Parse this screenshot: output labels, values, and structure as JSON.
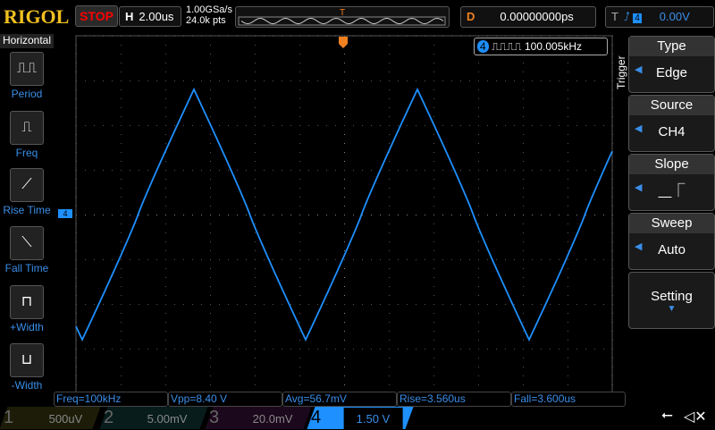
{
  "header": {
    "logo": "RIGOL",
    "run_state": "STOP",
    "h_label": "H",
    "timebase": "2.00us",
    "sample_rate": "1.00GSa/s",
    "memory_depth": "24.0k pts",
    "delay_label": "D",
    "delay": "0.00000000ps",
    "trigger_label": "T",
    "trigger_source": "4",
    "trigger_level": "0.00V"
  },
  "left_menu": {
    "title": "Horizontal",
    "items": [
      {
        "label": "Period"
      },
      {
        "label": "Freq"
      },
      {
        "label": "Rise Time"
      },
      {
        "label": "Fall Time"
      },
      {
        "label": "+Width"
      },
      {
        "label": "-Width"
      }
    ]
  },
  "freq_counter": {
    "channel": "4",
    "value": "100.005kHz"
  },
  "right_menu": {
    "title": "Trigger",
    "items": [
      {
        "title": "Type",
        "value": "Edge"
      },
      {
        "title": "Source",
        "value": "CH4"
      },
      {
        "title": "Slope",
        "value": "rising-edge"
      },
      {
        "title": "Sweep",
        "value": "Auto"
      }
    ],
    "setting": "Setting"
  },
  "measurements": [
    "Freq=100kHz",
    "Vpp=8.40 V",
    "Avg=56.7mV",
    "Rise=3.560us",
    "Fall=3.600us"
  ],
  "channels": [
    {
      "num": "1",
      "scale": "500uV",
      "color": "#c8c000"
    },
    {
      "num": "2",
      "scale": "5.00mV",
      "color": "#00c8c8"
    },
    {
      "num": "3",
      "scale": "20.0mV",
      "color": "#c000c0"
    },
    {
      "num": "4",
      "scale": "1.50 V",
      "color": "#1e90ff"
    }
  ],
  "ch_marker": "4"
}
